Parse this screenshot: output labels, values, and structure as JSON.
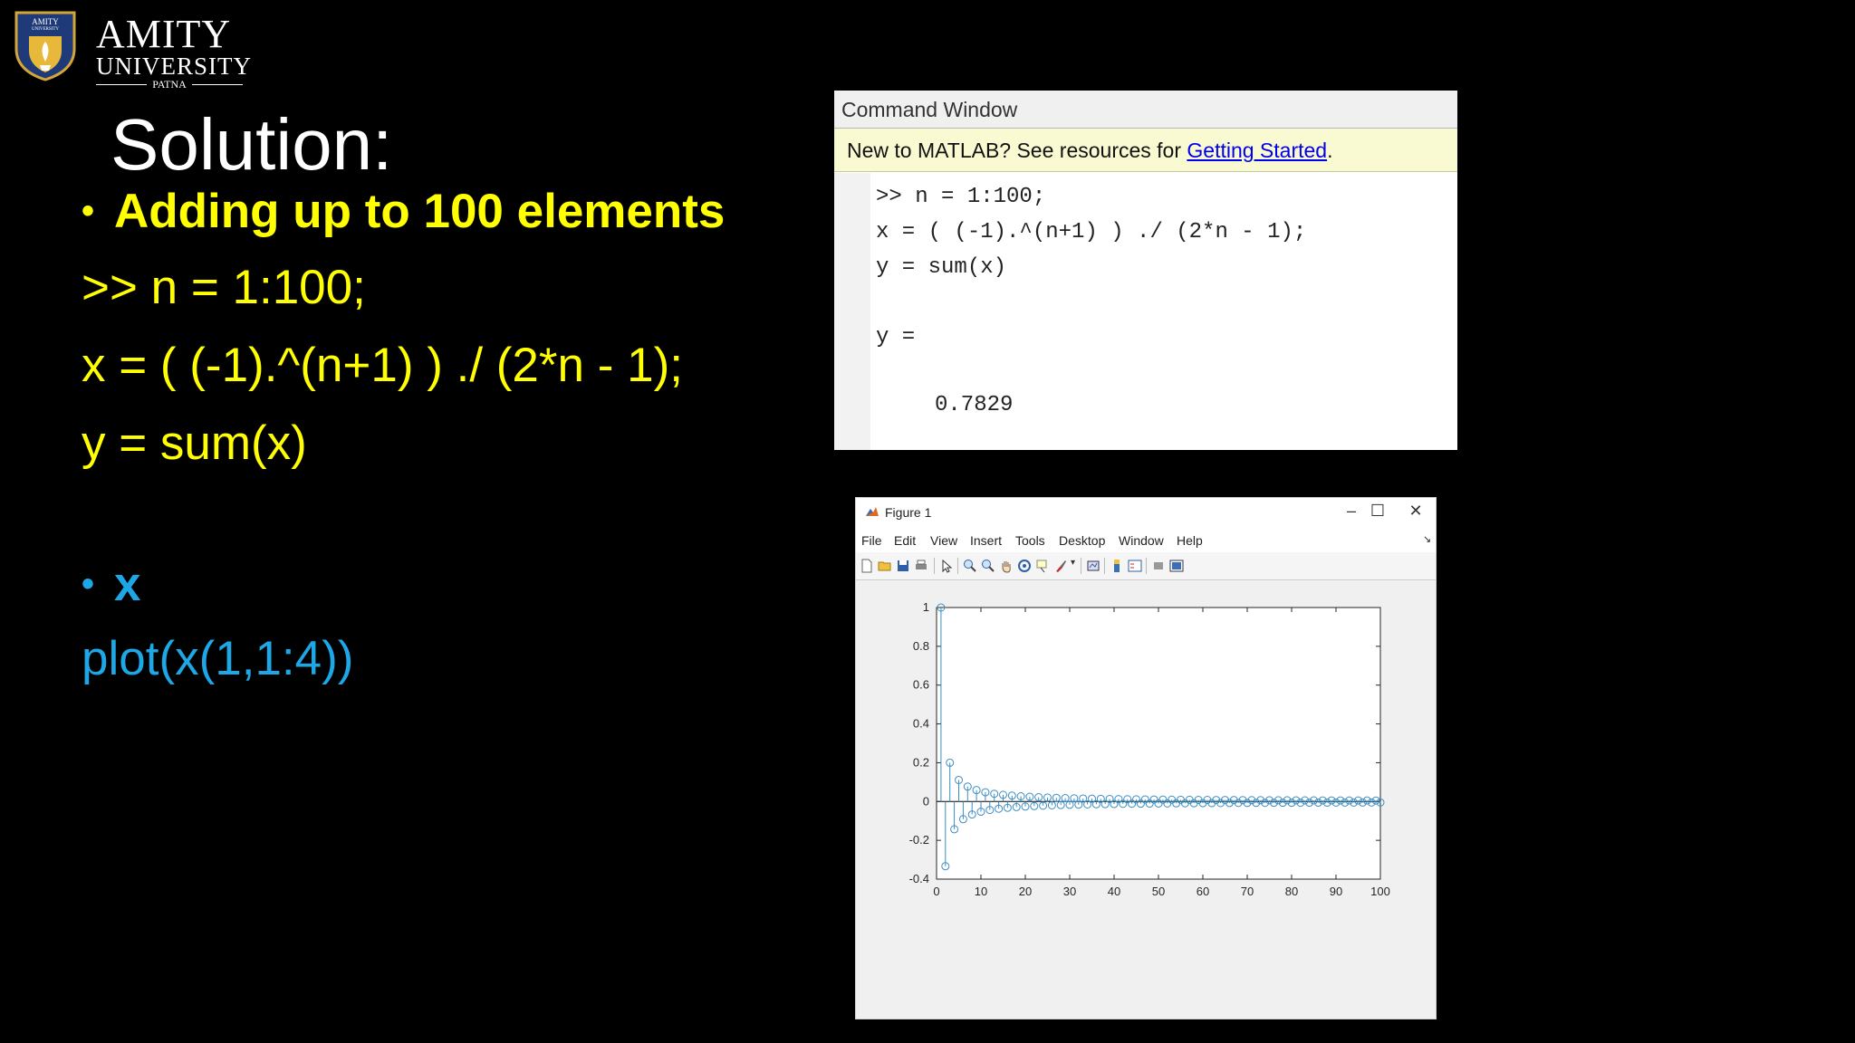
{
  "logo": {
    "name": "AMITY",
    "line2": "UNIVERSITY",
    "line3": "PATNA",
    "crest_text": "AMITY",
    "crest_subtext": "UNIVERSITY"
  },
  "slide": {
    "title": "Solution:",
    "bullet1": "Adding up to 100 elements",
    "code1": [
      ">> n = 1:100;",
      "x = ( (-1).^(n+1) ) ./ (2*n - 1);",
      "y = sum(x)"
    ],
    "bullet2": "x",
    "code2": "plot(x(1,1:4))",
    "colors": {
      "yellow": "#ffff00",
      "blue": "#1ea7e6"
    }
  },
  "command_window": {
    "title": "Command Window",
    "notice_prefix": "New to MATLAB? See resources for ",
    "notice_link": "Getting Started",
    "notice_suffix": ".",
    "lines": [
      ">> n = 1:100;",
      "x = ( (-1).^(n+1) ) ./ (2*n - 1);",
      "y = sum(x)",
      "y =",
      "0.7829"
    ]
  },
  "figure_window": {
    "title": "Figure 1",
    "controls": {
      "minimize": "–",
      "maximize": "☐",
      "close": "✕"
    },
    "dock_arrow": "↘",
    "menus": [
      "File",
      "Edit",
      "View",
      "Insert",
      "Tools",
      "Desktop",
      "Window",
      "Help"
    ],
    "toolbar_icons": [
      "new-figure-icon",
      "open-file-icon",
      "save-icon",
      "print-icon",
      "pointer-icon",
      "zoom-in-icon",
      "zoom-out-icon",
      "pan-hand-icon",
      "rotate-3d-icon",
      "data-cursor-icon",
      "brush-icon",
      "link-plot-icon",
      "colorbar-icon",
      "legend-icon",
      "hide-plot-tools-icon",
      "show-plot-tools-icon"
    ]
  },
  "chart_data": {
    "type": "stem",
    "x": [
      1,
      2,
      3,
      4,
      5,
      6,
      7,
      8,
      9,
      10,
      11,
      12,
      13,
      14,
      15,
      16,
      17,
      18,
      19,
      20,
      21,
      22,
      23,
      24,
      25,
      26,
      27,
      28,
      29,
      30,
      31,
      32,
      33,
      34,
      35,
      36,
      37,
      38,
      39,
      40,
      41,
      42,
      43,
      44,
      45,
      46,
      47,
      48,
      49,
      50,
      51,
      52,
      53,
      54,
      55,
      56,
      57,
      58,
      59,
      60,
      61,
      62,
      63,
      64,
      65,
      66,
      67,
      68,
      69,
      70,
      71,
      72,
      73,
      74,
      75,
      76,
      77,
      78,
      79,
      80,
      81,
      82,
      83,
      84,
      85,
      86,
      87,
      88,
      89,
      90,
      91,
      92,
      93,
      94,
      95,
      96,
      97,
      98,
      99,
      100
    ],
    "values": [
      1,
      -0.3333,
      0.2,
      -0.1429,
      0.1111,
      -0.0909,
      0.0769,
      -0.0667,
      0.0588,
      -0.0526,
      0.0476,
      -0.0435,
      0.04,
      -0.037,
      0.0345,
      -0.0323,
      0.0303,
      -0.0286,
      0.027,
      -0.0256,
      0.0244,
      -0.0233,
      0.0222,
      -0.0213,
      0.0204,
      -0.0196,
      0.0189,
      -0.0182,
      0.0175,
      -0.0169,
      0.0164,
      -0.0159,
      0.0154,
      -0.0149,
      0.0145,
      -0.0141,
      0.0137,
      -0.0133,
      0.013,
      -0.0127,
      0.0123,
      -0.012,
      0.0118,
      -0.0115,
      0.0112,
      -0.011,
      0.0108,
      -0.0105,
      0.0103,
      -0.0101,
      0.0099,
      -0.0097,
      0.0095,
      -0.0093,
      0.0092,
      -0.009,
      0.0088,
      -0.0087,
      0.0085,
      -0.0084,
      0.0083,
      -0.0081,
      0.008,
      -0.0079,
      0.0078,
      -0.0076,
      0.0075,
      -0.0074,
      0.0073,
      -0.0072,
      0.0071,
      -0.007,
      0.0069,
      -0.0068,
      0.0067,
      -0.0066,
      0.0065,
      -0.0064,
      0.0063,
      -0.0063,
      0.0062,
      -0.0061,
      0.006,
      -0.006,
      0.0059,
      -0.0058,
      0.0057,
      -0.0057,
      0.0056,
      -0.0056,
      0.0055,
      -0.0054,
      0.0054,
      -0.0053,
      0.0053,
      -0.0052,
      0.0052,
      -0.0051,
      0.0051,
      -0.005
    ],
    "xlim": [
      0,
      100
    ],
    "ylim": [
      -0.4,
      1
    ],
    "xticks": [
      0,
      10,
      20,
      30,
      40,
      50,
      60,
      70,
      80,
      90,
      100
    ],
    "yticks": [
      -0.4,
      -0.2,
      0,
      0.2,
      0.4,
      0.6,
      0.8,
      1
    ],
    "xtick_labels": [
      "0",
      "10",
      "20",
      "30",
      "40",
      "50",
      "60",
      "70",
      "80",
      "90",
      "100"
    ],
    "ytick_labels": [
      "-0.4",
      "-0.2",
      "0",
      "0.2",
      "0.4",
      "0.6",
      "0.8",
      "1"
    ],
    "color": "#3c8ec2",
    "grid": false
  }
}
